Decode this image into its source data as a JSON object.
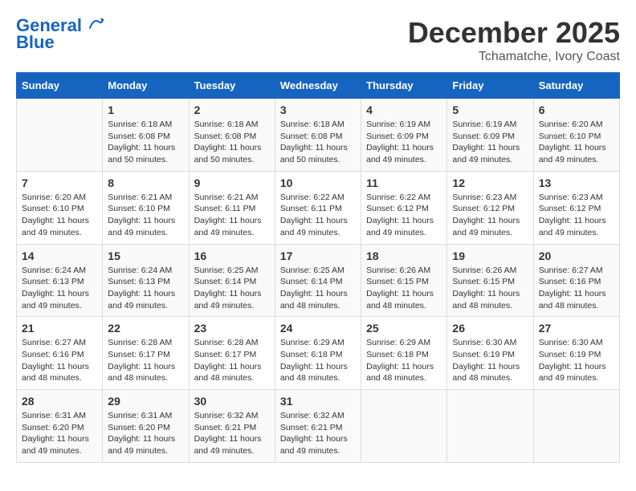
{
  "header": {
    "logo_line1": "General",
    "logo_line2": "Blue",
    "month": "December 2025",
    "location": "Tchamatche, Ivory Coast"
  },
  "weekdays": [
    "Sunday",
    "Monday",
    "Tuesday",
    "Wednesday",
    "Thursday",
    "Friday",
    "Saturday"
  ],
  "weeks": [
    [
      {
        "day": "",
        "info": ""
      },
      {
        "day": "1",
        "info": "Sunrise: 6:18 AM\nSunset: 6:08 PM\nDaylight: 11 hours\nand 50 minutes."
      },
      {
        "day": "2",
        "info": "Sunrise: 6:18 AM\nSunset: 6:08 PM\nDaylight: 11 hours\nand 50 minutes."
      },
      {
        "day": "3",
        "info": "Sunrise: 6:18 AM\nSunset: 6:08 PM\nDaylight: 11 hours\nand 50 minutes."
      },
      {
        "day": "4",
        "info": "Sunrise: 6:19 AM\nSunset: 6:09 PM\nDaylight: 11 hours\nand 49 minutes."
      },
      {
        "day": "5",
        "info": "Sunrise: 6:19 AM\nSunset: 6:09 PM\nDaylight: 11 hours\nand 49 minutes."
      },
      {
        "day": "6",
        "info": "Sunrise: 6:20 AM\nSunset: 6:10 PM\nDaylight: 11 hours\nand 49 minutes."
      }
    ],
    [
      {
        "day": "7",
        "info": "Sunrise: 6:20 AM\nSunset: 6:10 PM\nDaylight: 11 hours\nand 49 minutes."
      },
      {
        "day": "8",
        "info": "Sunrise: 6:21 AM\nSunset: 6:10 PM\nDaylight: 11 hours\nand 49 minutes."
      },
      {
        "day": "9",
        "info": "Sunrise: 6:21 AM\nSunset: 6:11 PM\nDaylight: 11 hours\nand 49 minutes."
      },
      {
        "day": "10",
        "info": "Sunrise: 6:22 AM\nSunset: 6:11 PM\nDaylight: 11 hours\nand 49 minutes."
      },
      {
        "day": "11",
        "info": "Sunrise: 6:22 AM\nSunset: 6:12 PM\nDaylight: 11 hours\nand 49 minutes."
      },
      {
        "day": "12",
        "info": "Sunrise: 6:23 AM\nSunset: 6:12 PM\nDaylight: 11 hours\nand 49 minutes."
      },
      {
        "day": "13",
        "info": "Sunrise: 6:23 AM\nSunset: 6:12 PM\nDaylight: 11 hours\nand 49 minutes."
      }
    ],
    [
      {
        "day": "14",
        "info": "Sunrise: 6:24 AM\nSunset: 6:13 PM\nDaylight: 11 hours\nand 49 minutes."
      },
      {
        "day": "15",
        "info": "Sunrise: 6:24 AM\nSunset: 6:13 PM\nDaylight: 11 hours\nand 49 minutes."
      },
      {
        "day": "16",
        "info": "Sunrise: 6:25 AM\nSunset: 6:14 PM\nDaylight: 11 hours\nand 49 minutes."
      },
      {
        "day": "17",
        "info": "Sunrise: 6:25 AM\nSunset: 6:14 PM\nDaylight: 11 hours\nand 48 minutes."
      },
      {
        "day": "18",
        "info": "Sunrise: 6:26 AM\nSunset: 6:15 PM\nDaylight: 11 hours\nand 48 minutes."
      },
      {
        "day": "19",
        "info": "Sunrise: 6:26 AM\nSunset: 6:15 PM\nDaylight: 11 hours\nand 48 minutes."
      },
      {
        "day": "20",
        "info": "Sunrise: 6:27 AM\nSunset: 6:16 PM\nDaylight: 11 hours\nand 48 minutes."
      }
    ],
    [
      {
        "day": "21",
        "info": "Sunrise: 6:27 AM\nSunset: 6:16 PM\nDaylight: 11 hours\nand 48 minutes."
      },
      {
        "day": "22",
        "info": "Sunrise: 6:28 AM\nSunset: 6:17 PM\nDaylight: 11 hours\nand 48 minutes."
      },
      {
        "day": "23",
        "info": "Sunrise: 6:28 AM\nSunset: 6:17 PM\nDaylight: 11 hours\nand 48 minutes."
      },
      {
        "day": "24",
        "info": "Sunrise: 6:29 AM\nSunset: 6:18 PM\nDaylight: 11 hours\nand 48 minutes."
      },
      {
        "day": "25",
        "info": "Sunrise: 6:29 AM\nSunset: 6:18 PM\nDaylight: 11 hours\nand 48 minutes."
      },
      {
        "day": "26",
        "info": "Sunrise: 6:30 AM\nSunset: 6:19 PM\nDaylight: 11 hours\nand 48 minutes."
      },
      {
        "day": "27",
        "info": "Sunrise: 6:30 AM\nSunset: 6:19 PM\nDaylight: 11 hours\nand 49 minutes."
      }
    ],
    [
      {
        "day": "28",
        "info": "Sunrise: 6:31 AM\nSunset: 6:20 PM\nDaylight: 11 hours\nand 49 minutes."
      },
      {
        "day": "29",
        "info": "Sunrise: 6:31 AM\nSunset: 6:20 PM\nDaylight: 11 hours\nand 49 minutes."
      },
      {
        "day": "30",
        "info": "Sunrise: 6:32 AM\nSunset: 6:21 PM\nDaylight: 11 hours\nand 49 minutes."
      },
      {
        "day": "31",
        "info": "Sunrise: 6:32 AM\nSunset: 6:21 PM\nDaylight: 11 hours\nand 49 minutes."
      },
      {
        "day": "",
        "info": ""
      },
      {
        "day": "",
        "info": ""
      },
      {
        "day": "",
        "info": ""
      }
    ]
  ]
}
